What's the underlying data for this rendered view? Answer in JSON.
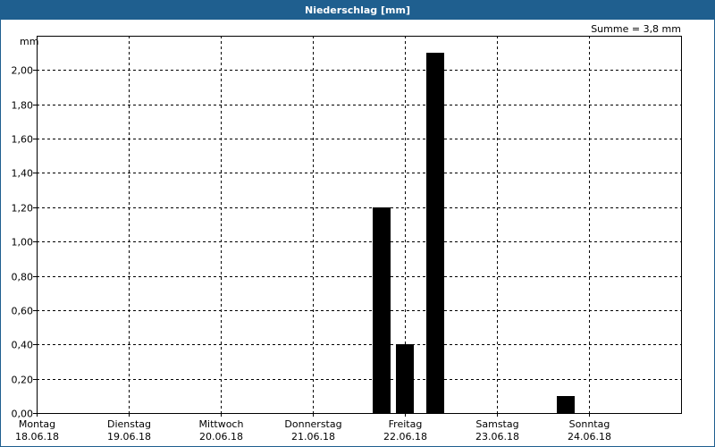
{
  "window": {
    "title": "Niederschlag [mm]"
  },
  "sum_label": "Summe = 3,8 mm",
  "chart_data": {
    "type": "bar",
    "title": "Niederschlag [mm]",
    "ylabel": "mm",
    "ylim": [
      0,
      2.2
    ],
    "yticks": [
      "0,00",
      "0,20",
      "0,40",
      "0,60",
      "0,80",
      "1,00",
      "1,20",
      "1,40",
      "1,60",
      "1,80",
      "2,00"
    ],
    "grid": true,
    "days": [
      {
        "weekday": "Montag",
        "date": "18.06.18"
      },
      {
        "weekday": "Dienstag",
        "date": "19.06.18"
      },
      {
        "weekday": "Mittwoch",
        "date": "20.06.18"
      },
      {
        "weekday": "Donnerstag",
        "date": "21.06.18"
      },
      {
        "weekday": "Freitag",
        "date": "22.06.18"
      },
      {
        "weekday": "Samstag",
        "date": "23.06.18"
      },
      {
        "weekday": "Sonntag",
        "date": "24.06.18"
      }
    ],
    "bars": [
      {
        "date": "21.06.18",
        "time": "18:00",
        "value": 1.2
      },
      {
        "date": "22.06.18",
        "time": "00:00",
        "value": 0.4
      },
      {
        "date": "22.06.18",
        "time": "08:00",
        "value": 2.1
      },
      {
        "date": "23.06.18",
        "time": "18:00",
        "value": 0.1
      }
    ],
    "bar_color": "#000000"
  }
}
